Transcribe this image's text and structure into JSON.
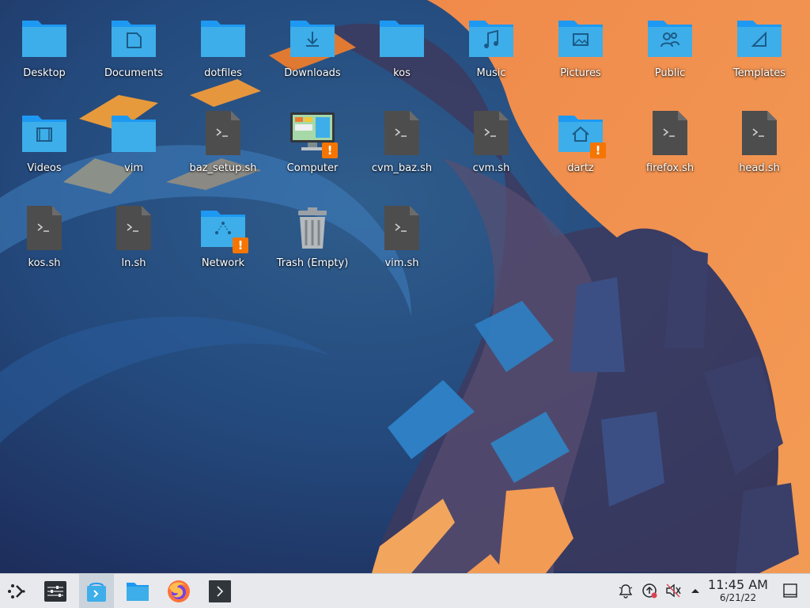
{
  "desktop": {
    "row1": [
      {
        "label": "Desktop",
        "icon": "folder-icon"
      },
      {
        "label": "Documents",
        "icon": "folder-documents-icon"
      },
      {
        "label": "dotfiles",
        "icon": "folder-icon"
      },
      {
        "label": "Downloads",
        "icon": "folder-downloads-icon"
      },
      {
        "label": "kos",
        "icon": "folder-icon"
      },
      {
        "label": "Music",
        "icon": "folder-music-icon"
      },
      {
        "label": "Pictures",
        "icon": "folder-pictures-icon"
      },
      {
        "label": "Public",
        "icon": "folder-public-icon"
      },
      {
        "label": "Templates",
        "icon": "folder-templates-icon"
      }
    ],
    "row2": [
      {
        "label": "Videos",
        "icon": "folder-videos-icon"
      },
      {
        "label": "vim",
        "icon": "folder-icon"
      },
      {
        "label": "baz_setup.sh",
        "icon": "shell-script-icon"
      },
      {
        "label": "Computer",
        "icon": "computer-icon",
        "badge": "!"
      },
      {
        "label": "cvm_baz.sh",
        "icon": "shell-script-icon"
      },
      {
        "label": "cvm.sh",
        "icon": "shell-script-icon"
      },
      {
        "label": "dartz",
        "icon": "folder-home-icon",
        "badge": "!"
      },
      {
        "label": "firefox.sh",
        "icon": "shell-script-icon"
      },
      {
        "label": "head.sh",
        "icon": "shell-script-icon"
      }
    ],
    "row3": [
      {
        "label": "kos.sh",
        "icon": "shell-script-icon"
      },
      {
        "label": "ln.sh",
        "icon": "shell-script-icon"
      },
      {
        "label": "Network",
        "icon": "folder-network-icon",
        "badge": "!"
      },
      {
        "label": "Trash (Empty)",
        "icon": "trash-empty-icon"
      },
      {
        "label": "vim.sh",
        "icon": "shell-script-icon"
      }
    ]
  },
  "taskbar": {
    "launchers": [
      {
        "name": "application-launcher-icon"
      },
      {
        "name": "system-settings-icon"
      },
      {
        "name": "discover-store-icon"
      },
      {
        "name": "dolphin-file-manager-icon"
      },
      {
        "name": "firefox-icon"
      },
      {
        "name": "konsole-terminal-icon"
      }
    ],
    "tray": [
      {
        "name": "notifications-icon"
      },
      {
        "name": "update-notifier-icon"
      },
      {
        "name": "volume-muted-icon"
      },
      {
        "name": "expand-tray-icon"
      }
    ],
    "clock": {
      "time": "11:45 AM",
      "date": "6/21/22"
    },
    "show_desktop": "show-desktop-icon"
  },
  "colors": {
    "folder": "#3daee9",
    "folder_dark": "#1d99f3",
    "script": "#4d4d4d",
    "warning": "#f67400",
    "panel": "#e7e9ec"
  }
}
